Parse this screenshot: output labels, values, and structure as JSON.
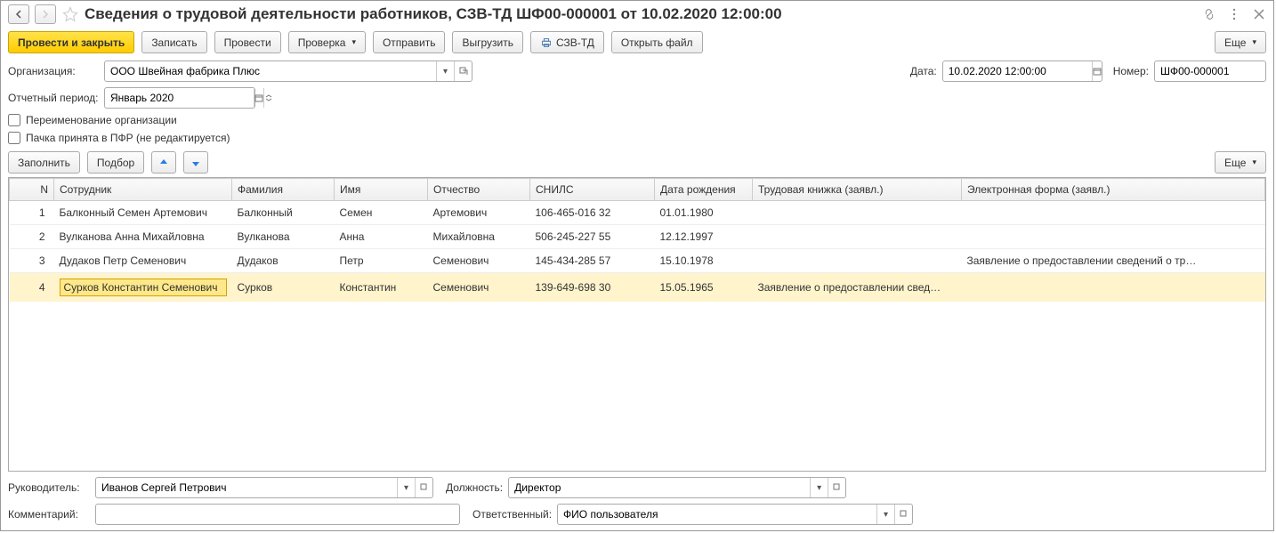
{
  "title": "Сведения о трудовой деятельности работников, СЗВ-ТД ШФ00-000001 от 10.02.2020 12:00:00",
  "toolbar": {
    "post_close": "Провести и закрыть",
    "save": "Записать",
    "post": "Провести",
    "check": "Проверка",
    "send": "Отправить",
    "export": "Выгрузить",
    "szvtd": "СЗВ-ТД",
    "open_file": "Открыть файл",
    "more": "Еще"
  },
  "form": {
    "org_label": "Организация:",
    "org_value": "ООО Швейная фабрика Плюс",
    "date_label": "Дата:",
    "date_value": "10.02.2020 12:00:00",
    "num_label": "Номер:",
    "num_value": "ШФ00-000001",
    "period_label": "Отчетный период:",
    "period_value": "Январь 2020",
    "rename_label": "Переименование организации",
    "accepted_label": "Пачка принята в ПФР (не редактируется)"
  },
  "tabletools": {
    "fill": "Заполнить",
    "pick": "Подбор",
    "more": "Еще"
  },
  "columns": {
    "n": "N",
    "emp": "Сотрудник",
    "last": "Фамилия",
    "first": "Имя",
    "mid": "Отчество",
    "snils": "СНИЛС",
    "birth": "Дата рождения",
    "book": "Трудовая книжка (заявл.)",
    "eform": "Электронная форма (заявл.)"
  },
  "rows": [
    {
      "n": "1",
      "emp": "Балконный Семен Артемович",
      "last": "Балконный",
      "first": "Семен",
      "mid": "Артемович",
      "snils": "106-465-016 32",
      "birth": "01.01.1980",
      "book": "",
      "eform": ""
    },
    {
      "n": "2",
      "emp": "Вулканова Анна Михайловна",
      "last": "Вулканова",
      "first": "Анна",
      "mid": "Михайловна",
      "snils": "506-245-227 55",
      "birth": "12.12.1997",
      "book": "",
      "eform": ""
    },
    {
      "n": "3",
      "emp": "Дудаков Петр Семенович",
      "last": "Дудаков",
      "first": "Петр",
      "mid": "Семенович",
      "snils": "145-434-285 57",
      "birth": "15.10.1978",
      "book": "",
      "eform": "Заявление о предоставлении сведений о тр…"
    },
    {
      "n": "4",
      "emp": "Сурков Константин Семенович",
      "last": "Сурков",
      "first": "Константин",
      "mid": "Семенович",
      "snils": "139-649-698 30",
      "birth": "15.05.1965",
      "book": "Заявление о предоставлении свед…",
      "eform": ""
    }
  ],
  "selected_row": 3,
  "footer": {
    "head_label": "Руководитель:",
    "head_value": "Иванов Сергей Петрович",
    "pos_label": "Должность:",
    "pos_value": "Директор",
    "comment_label": "Комментарий:",
    "comment_value": "",
    "resp_label": "Ответственный:",
    "resp_value": "ФИО пользователя"
  }
}
